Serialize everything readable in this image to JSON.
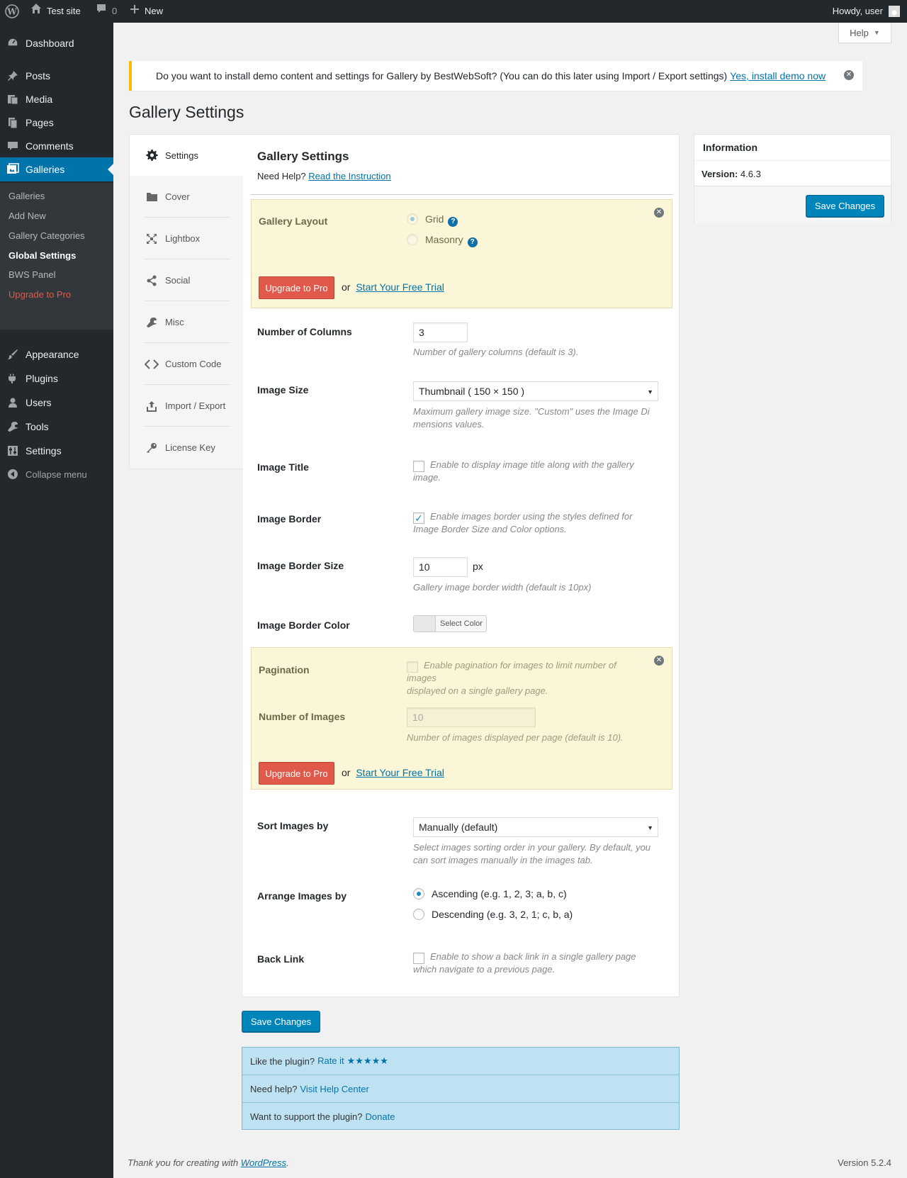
{
  "adminbar": {
    "site_name": "Test site",
    "comments_count": "0",
    "new_label": "New",
    "howdy": "Howdy, user"
  },
  "sidebar": {
    "items": [
      {
        "label": "Dashboard",
        "icon": "dashboard-icon"
      },
      {
        "label": "Posts",
        "icon": "pin-icon"
      },
      {
        "label": "Media",
        "icon": "media-icon"
      },
      {
        "label": "Pages",
        "icon": "pages-icon"
      },
      {
        "label": "Comments",
        "icon": "comment-icon"
      },
      {
        "label": "Galleries",
        "icon": "gallery-icon"
      },
      {
        "label": "Appearance",
        "icon": "brush-icon"
      },
      {
        "label": "Plugins",
        "icon": "plugin-icon"
      },
      {
        "label": "Users",
        "icon": "user-icon"
      },
      {
        "label": "Tools",
        "icon": "wrench-icon"
      },
      {
        "label": "Settings",
        "icon": "sliders-icon"
      }
    ],
    "submenu": [
      "Galleries",
      "Add New",
      "Gallery Categories",
      "Global Settings",
      "BWS Panel",
      "Upgrade to Pro"
    ],
    "collapse": "Collapse menu"
  },
  "help_tab": "Help",
  "notice": {
    "text": "Do you want to install demo content and settings for Gallery by BestWebSoft? (You can do this later using Import / Export settings)",
    "link": "Yes, install demo now"
  },
  "page_title": "Gallery Settings",
  "tabs": [
    "Settings",
    "Cover",
    "Lightbox",
    "Social",
    "Misc",
    "Custom Code",
    "Import / Export",
    "License Key"
  ],
  "main": {
    "heading": "Gallery Settings",
    "need_help": "Need Help?",
    "instruction_link": "Read the Instruction",
    "layout": {
      "label": "Gallery Layout",
      "options": [
        "Grid",
        "Masonry"
      ],
      "selected": "Grid"
    },
    "upgrade_btn": "Upgrade to Pro",
    "or": "or",
    "trial_link": "Start Your Free Trial",
    "columns": {
      "label": "Number of Columns",
      "value": "3",
      "desc": "Number of gallery columns (default is 3)."
    },
    "image_size": {
      "label": "Image Size",
      "value": "Thumbnail ( 150 × 150 )",
      "desc_line1": "Maximum gallery image size. \"Custom\" uses the Image Di",
      "desc_line2": "mensions values."
    },
    "image_title": {
      "label": "Image Title",
      "checked": false,
      "desc_line1": "Enable to display image title along with the gallery",
      "desc_line2": "image."
    },
    "image_border": {
      "label": "Image Border",
      "checked": true,
      "desc_line1": "Enable images border using the styles defined for",
      "desc_line2": "Image Border Size and Color options."
    },
    "border_size": {
      "label": "Image Border Size",
      "value": "10",
      "unit": "px",
      "desc": "Gallery image border width (default is 10px)"
    },
    "border_color": {
      "label": "Image Border Color",
      "button": "Select Color"
    },
    "pagination": {
      "label": "Pagination",
      "desc_line1": "Enable pagination for images to limit number of images",
      "desc_line2": "displayed on a single gallery page."
    },
    "num_images": {
      "label": "Number of Images",
      "value": "10",
      "desc": "Number of images displayed per page (default is 10)."
    },
    "sort": {
      "label": "Sort Images by",
      "value": "Manually (default)",
      "desc_line1": "Select images sorting order in your gallery. By default, you",
      "desc_line2": "can sort images manually in the images tab."
    },
    "arrange": {
      "label": "Arrange Images by",
      "options": [
        "Ascending (e.g. 1, 2, 3; a, b, c)",
        "Descending (e.g. 3, 2, 1; c, b, a)"
      ],
      "selected": "Ascending (e.g. 1, 2, 3; a, b, c)"
    },
    "back_link": {
      "label": "Back Link",
      "checked": false,
      "desc_line1": "Enable to show a back link in a single gallery page",
      "desc_line2": "which navigate to a previous page."
    }
  },
  "save_changes": "Save Changes",
  "info": {
    "title": "Information",
    "version_label": "Version:",
    "version_value": "4.6.3",
    "save": "Save Changes"
  },
  "rate": {
    "like": "Like the plugin?",
    "rate_it": "Rate it",
    "stars": "★★★★★",
    "need_help": "Need help?",
    "help_link": "Visit Help Center",
    "support": "Want to support the plugin?",
    "donate": "Donate"
  },
  "footer": {
    "thanks": "Thank you for creating with",
    "wp_link": "WordPress",
    "period": ".",
    "version": "Version 5.2.4"
  }
}
